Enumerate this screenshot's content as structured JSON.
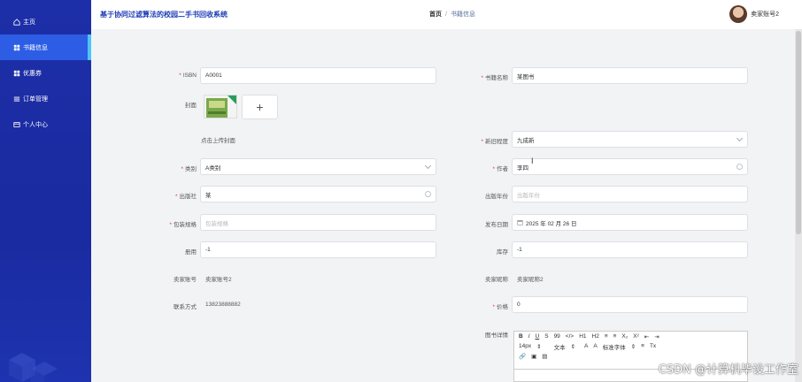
{
  "app": {
    "title": "基于协同过滤算法的校园二手书回收系统"
  },
  "breadcrumb": {
    "home": "首页",
    "separator": "/",
    "current": "书籍信息"
  },
  "user": {
    "name": "卖家账号2"
  },
  "sidebar": {
    "items": [
      {
        "label": "主页",
        "icon": "home-icon",
        "active": false
      },
      {
        "label": "书籍信息",
        "icon": "grid-icon",
        "active": true
      },
      {
        "label": "优惠券",
        "icon": "grid-icon",
        "active": false
      },
      {
        "label": "订单管理",
        "icon": "list-icon",
        "active": false
      },
      {
        "label": "个人中心",
        "icon": "card-icon",
        "active": false
      }
    ]
  },
  "form": {
    "isbn": {
      "label": "ISBN",
      "value": "A0001"
    },
    "book_name": {
      "label": "书籍名称",
      "value": "某图书"
    },
    "cover": {
      "label": "封面",
      "add": "+",
      "hint": "点击上传封面"
    },
    "condition": {
      "label": "新旧程度",
      "value": "九成新"
    },
    "category": {
      "label": "类别",
      "value": "A类别"
    },
    "author": {
      "label": "作者",
      "value": "李四"
    },
    "publisher": {
      "label": "出版社",
      "value": "某"
    },
    "publish_year": {
      "label": "出版年份",
      "placeholder": "出版年份"
    },
    "packaging": {
      "label": "包装规格",
      "placeholder": "包装规格"
    },
    "release_date": {
      "label": "发布日期",
      "value": "2025 年 02 月 26 日"
    },
    "volumes": {
      "label": "册用",
      "value": "-1"
    },
    "stock": {
      "label": "库存",
      "value": "-1"
    },
    "seller_account": {
      "label": "卖家账号",
      "value": "卖家账号2"
    },
    "seller_nickname": {
      "label": "卖家昵称",
      "value": "卖家昵称2"
    },
    "contact": {
      "label": "联系方式",
      "value": "13823888882"
    },
    "price": {
      "label": "价格",
      "value": "0"
    },
    "details": {
      "label": "图书详情"
    }
  },
  "editor": {
    "row1": [
      "B",
      "I",
      "U",
      "S",
      "99",
      "</>",
      "H1",
      "H2",
      "≡",
      "≡",
      "X₂",
      "X²",
      "⇤",
      "⇥"
    ],
    "row2": [
      "14px",
      "⇕",
      "文本",
      "⇕",
      "A",
      "A",
      "标准字体",
      "⇕",
      "≡",
      "Tx"
    ],
    "row3": [
      "🔗",
      "▣",
      "▤"
    ]
  },
  "watermark": "CSDN @计算机毕设工作室",
  "colors": {
    "sidebar": "#1d2fa8",
    "active": "#2d5de4",
    "accent": "#4fc3f7",
    "title": "#1d3bb5"
  }
}
